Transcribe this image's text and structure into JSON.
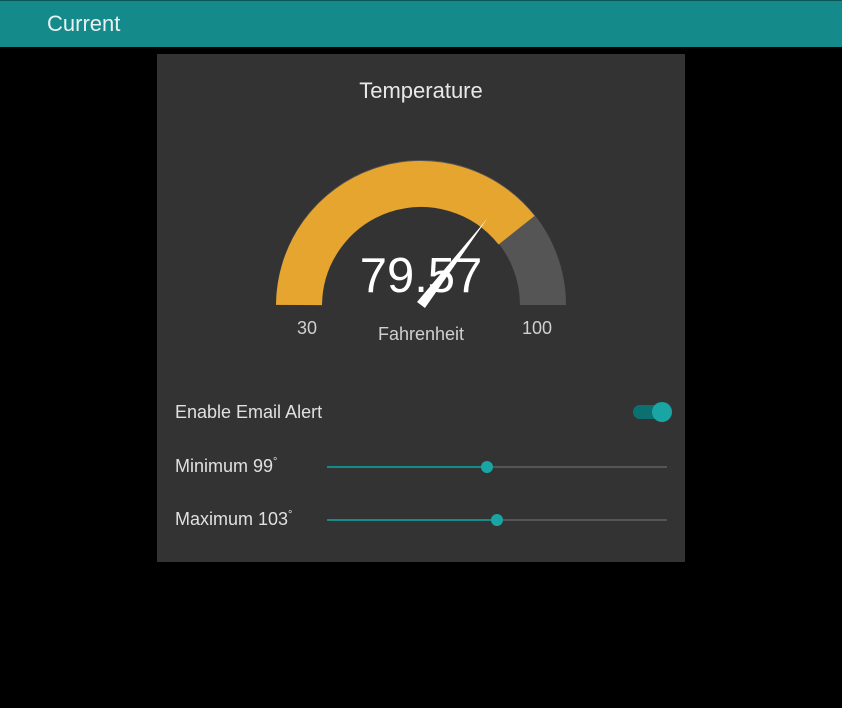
{
  "header": {
    "title": "Current"
  },
  "card": {
    "title": "Temperature"
  },
  "gauge": {
    "value": "79.57",
    "unit": "Fahrenheit",
    "min": "30",
    "max": "100",
    "min_val": 30,
    "max_val": 100,
    "current_val": 79.57
  },
  "alert": {
    "label": "Enable Email Alert",
    "enabled": true
  },
  "sliders": {
    "minimum": {
      "label": "Minimum 99",
      "degree": "°",
      "percent": 47
    },
    "maximum": {
      "label": "Maximum 103",
      "degree": "°",
      "percent": 50
    }
  },
  "colors": {
    "accent": "#148a8a",
    "gauge_fill": "#e6a52e",
    "gauge_bg": "#555555"
  }
}
